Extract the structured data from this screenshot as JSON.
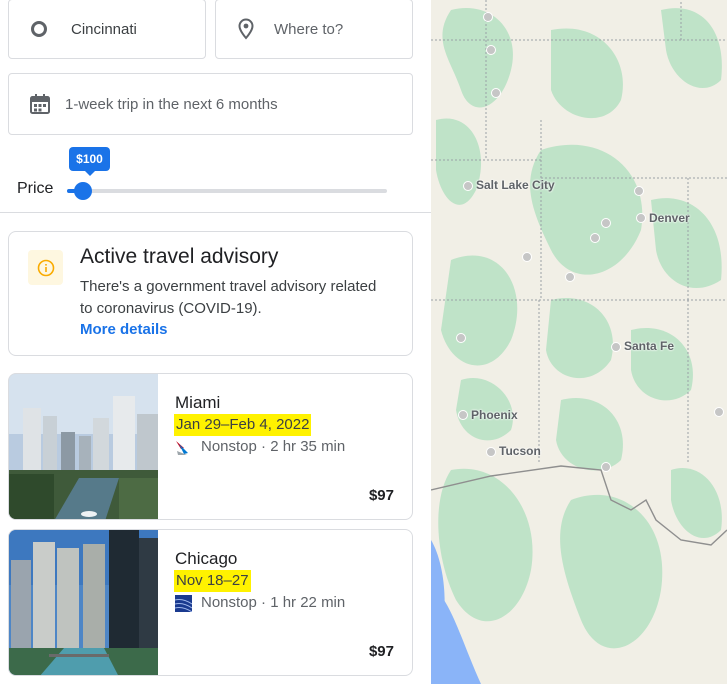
{
  "search": {
    "origin_value": "Cincinnati",
    "destination_placeholder": "Where to?",
    "dates_value": "1-week trip in the next 6 months"
  },
  "price_filter": {
    "label": "Price",
    "max_price_label": "$100",
    "fill_fraction": 0.04
  },
  "advisory": {
    "title": "Active travel advisory",
    "body": "There's a government travel advisory related to coronavirus (COVID-19).",
    "link": "More details"
  },
  "destinations": [
    {
      "city": "Miami",
      "dates": "Jan 29–Feb 4, 2022",
      "flight": "Nonstop · 2 hr 35 min",
      "price": "$97",
      "airline_icon": "american-airlines-logo"
    },
    {
      "city": "Chicago",
      "dates": "Nov 18–27",
      "flight": "Nonstop · 1 hr 22 min",
      "price": "$97",
      "airline_icon": "united-airlines-logo"
    }
  ],
  "map": {
    "labels": {
      "salt_lake_city": "Salt Lake City",
      "denver": "Denver",
      "santa_fe": "Santa Fe",
      "phoenix": "Phoenix",
      "tucson": "Tucson"
    },
    "colors": {
      "land": "#f1efe6",
      "forest": "#bfe3c8",
      "water": "#8ab4f8"
    }
  },
  "colors": {
    "accent": "#1a73e8",
    "highlight": "#fff200"
  }
}
